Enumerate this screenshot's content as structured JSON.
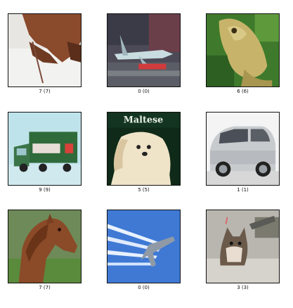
{
  "grid": {
    "items": [
      {
        "label": "7 (7)",
        "subject": "horse"
      },
      {
        "label": "0 (0)",
        "subject": "airplane"
      },
      {
        "label": "6 (6)",
        "subject": "frog"
      },
      {
        "label": "9 (9)",
        "subject": "truck"
      },
      {
        "label": "5 (5)",
        "subject": "dog",
        "overlay_text": "Maltese"
      },
      {
        "label": "1 (1)",
        "subject": "automobile"
      },
      {
        "label": "7 (7)",
        "subject": "horse"
      },
      {
        "label": "0 (0)",
        "subject": "airplane"
      },
      {
        "label": "3 (3)",
        "subject": "cat"
      }
    ]
  }
}
